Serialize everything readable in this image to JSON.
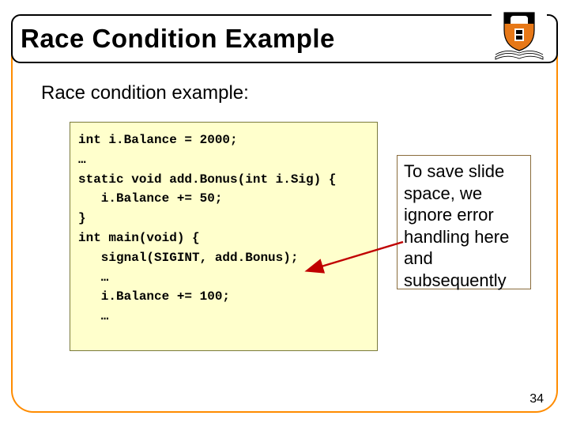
{
  "title": "Race Condition Example",
  "subtitle": "Race condition example:",
  "code": "int i.Balance = 2000;\n…\nstatic void add.Bonus(int i.Sig) {\n   i.Balance += 50;\n}\nint main(void) {\n   signal(SIGINT, add.Bonus);\n   …\n   i.Balance += 100;\n   …",
  "note": "To save slide space, we ignore error handling here and subsequently",
  "page_number": "34",
  "colors": {
    "code_bg": "#ffffcc",
    "border_orange": "#ff8c00",
    "arrow": "#c00000",
    "shield": "#e77817"
  }
}
